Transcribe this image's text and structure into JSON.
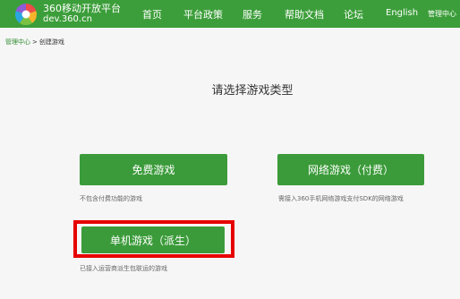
{
  "header": {
    "brand_name": "360移动开放平台",
    "brand_domain": "dev.360.cn",
    "nav": {
      "home": "首页",
      "policy": "平台政策",
      "service": "服务",
      "docs": "帮助文档",
      "forum": "论坛",
      "english": "English",
      "admin": "管理中心"
    },
    "colors": {
      "bar": "#3c9e3a"
    }
  },
  "breadcrumb": {
    "parent": "管理中心",
    "separator": ">",
    "current": "创建游戏"
  },
  "main": {
    "title": "请选择游戏类型",
    "options": {
      "free": {
        "label": "免费游戏",
        "description": "不包含付费功能的游戏"
      },
      "online": {
        "label": "网络游戏（付费）",
        "description": "需接入360手机网络游戏支付SDK的网络游戏"
      },
      "single": {
        "label": "单机游戏（派生）",
        "description": "已接入运营商派生包联运的游戏"
      }
    },
    "colors": {
      "button": "#3b9b3a",
      "highlight": "#e60000"
    }
  }
}
